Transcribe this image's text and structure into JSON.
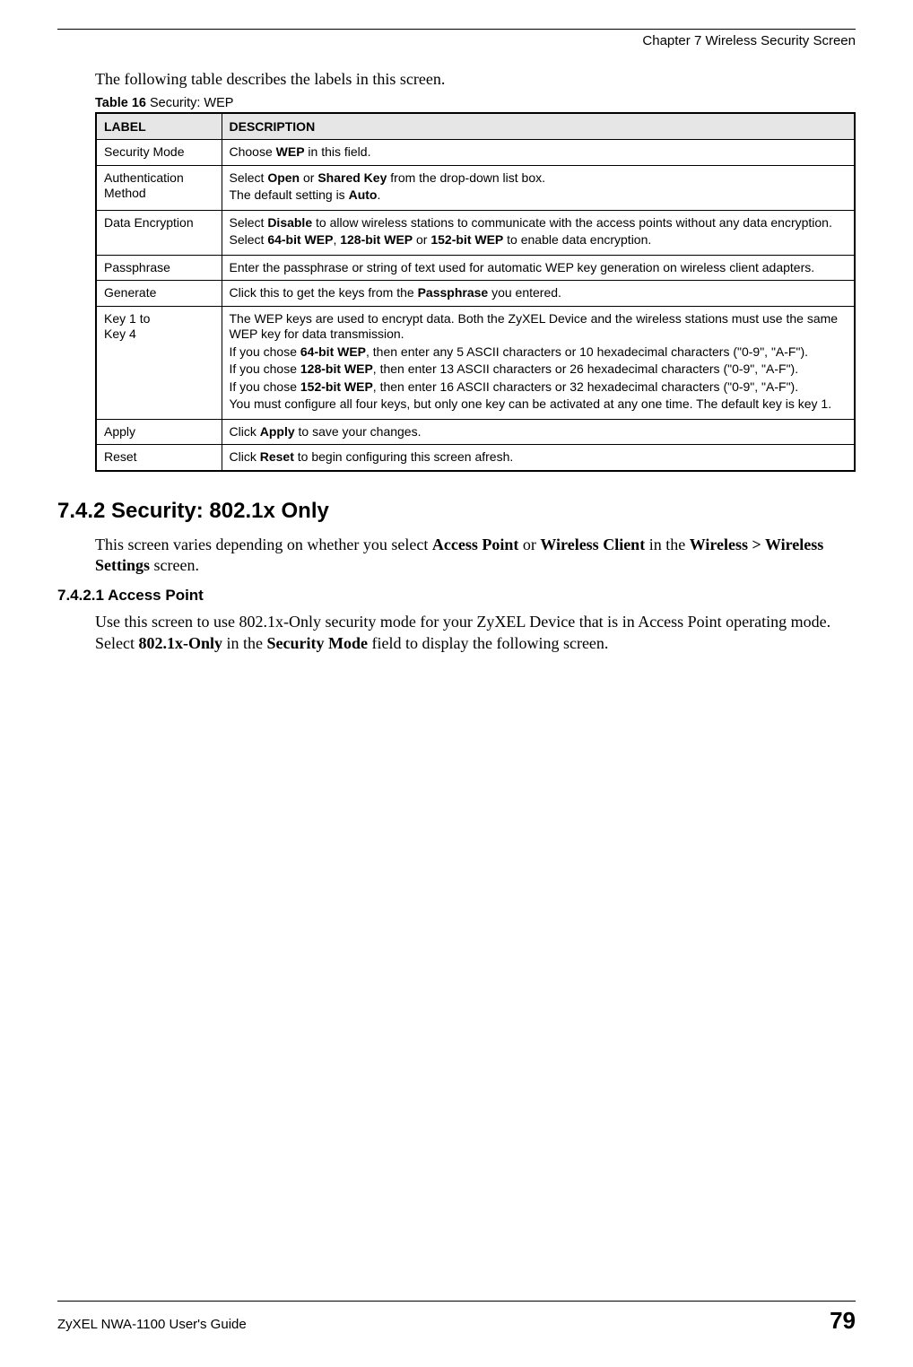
{
  "header": {
    "chapter_title": "Chapter 7 Wireless Security Screen"
  },
  "intro": "The following table describes the labels in this screen.",
  "table": {
    "caption_prefix": "Table 16",
    "caption_title": "   Security: WEP",
    "col_label": "LABEL",
    "col_desc": "DESCRIPTION",
    "rows": {
      "security_mode": {
        "label": "Security Mode",
        "d1a": "Choose ",
        "d1b": "WEP",
        "d1c": " in this field."
      },
      "auth_method": {
        "label_l1": "Authentication",
        "label_l2": "Method",
        "d1a": "Select ",
        "d1b": "Open",
        "d1c": " or ",
        "d1d": "Shared Key",
        "d1e": " from the drop-down list box.",
        "d2a": "The default setting is ",
        "d2b": "Auto",
        "d2c": "."
      },
      "data_enc": {
        "label": "Data Encryption",
        "d1a": "Select ",
        "d1b": "Disable",
        "d1c": " to allow wireless stations to communicate with the access points without any data encryption.",
        "d2a": "Select ",
        "d2b": "64-bit WEP",
        "d2c": ", ",
        "d2d": "128-bit WEP",
        "d2e": " or ",
        "d2f": "152-bit WEP",
        "d2g": " to enable data encryption."
      },
      "passphrase": {
        "label": "Passphrase",
        "d1": "Enter the passphrase or string of text used for automatic WEP key generation on wireless client adapters."
      },
      "generate": {
        "label": "Generate",
        "d1a": "Click this to get the keys from the ",
        "d1b": "Passphrase",
        "d1c": " you entered."
      },
      "keys": {
        "label_l1": "Key 1 to",
        "label_l2": "Key 4",
        "d1": "The WEP keys are used to encrypt data. Both the ZyXEL Device and the wireless stations must use the same WEP key for data transmission.",
        "d2a": "If you chose ",
        "d2b": "64-bit WEP",
        "d2c": ", then enter any 5 ASCII characters or 10 hexadecimal characters (\"0-9\", \"A-F\").",
        "d3a": "If you chose ",
        "d3b": "128-bit WEP",
        "d3c": ", then enter 13 ASCII characters or 26 hexadecimal characters (\"0-9\", \"A-F\").",
        "d4a": "If you chose ",
        "d4b": "152-bit WEP",
        "d4c": ", then enter 16 ASCII characters or 32 hexadecimal characters (\"0-9\", \"A-F\").",
        "d5": "You must configure all four keys, but only one key can be activated at any one time. The default key is key 1."
      },
      "apply": {
        "label": "Apply",
        "d1a": "Click ",
        "d1b": "Apply",
        "d1c": " to save your changes."
      },
      "reset": {
        "label": "Reset",
        "d1a": "Click ",
        "d1b": "Reset",
        "d1c": " to begin configuring this screen afresh."
      }
    }
  },
  "section742": {
    "heading": "7.4.2  Security: 802.1x Only",
    "p1a": "This screen varies depending on whether you select ",
    "p1b": "Access Point",
    "p1c": " or ",
    "p1d": "Wireless Client",
    "p1e": " in the ",
    "p1f": "Wireless > Wireless Settings",
    "p1g": " screen."
  },
  "section7421": {
    "heading": "7.4.2.1  Access Point",
    "p1a": "Use this screen to use 802.1x-Only security mode for your ZyXEL Device that is in Access Point operating mode. Select ",
    "p1b": "802.1x-Only",
    "p1c": " in the ",
    "p1d": "Security Mode",
    "p1e": " field to display the following screen."
  },
  "footer": {
    "guide": "ZyXEL NWA-1100 User's Guide",
    "page": "79"
  }
}
